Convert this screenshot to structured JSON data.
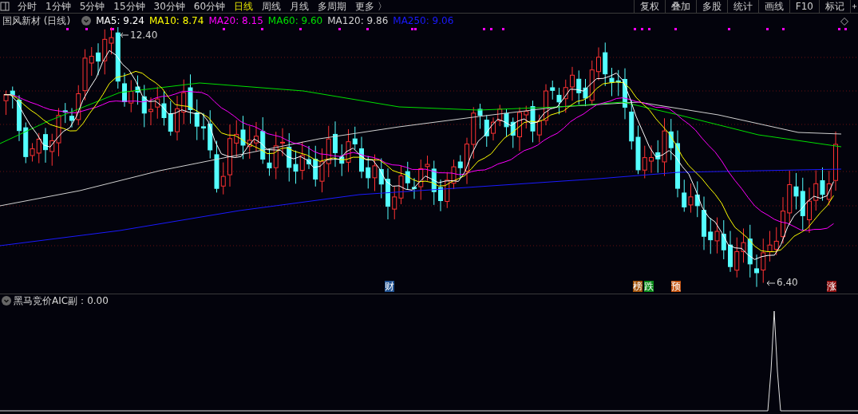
{
  "toolbar": {
    "periods": [
      {
        "label": "分时",
        "selected": false
      },
      {
        "label": "1分钟",
        "selected": false
      },
      {
        "label": "5分钟",
        "selected": false
      },
      {
        "label": "15分钟",
        "selected": false
      },
      {
        "label": "30分钟",
        "selected": false
      },
      {
        "label": "60分钟",
        "selected": false
      },
      {
        "label": "日线",
        "selected": true
      },
      {
        "label": "周线",
        "selected": false
      },
      {
        "label": "月线",
        "selected": false
      },
      {
        "label": "多周期",
        "selected": false
      },
      {
        "label": "更多 〉",
        "selected": false
      }
    ],
    "tools": [
      "复权",
      "叠加",
      "多股",
      "统计",
      "画线",
      "F10",
      "标记"
    ]
  },
  "chart": {
    "title": "国风新材 (日线)",
    "legend": [
      {
        "label": "MA5: 9.24",
        "color": "#ffffff"
      },
      {
        "label": "MA10: 8.74",
        "color": "#ffff00"
      },
      {
        "label": "MA20: 8.15",
        "color": "#ff00ff"
      },
      {
        "label": "MA60: 9.60",
        "color": "#00e000"
      },
      {
        "label": "MA120: 9.86",
        "color": "#d0d0d0"
      },
      {
        "label": "MA250: 9.06",
        "color": "#1a1aff"
      }
    ],
    "high_label": "12.40",
    "low_label": "6.40",
    "events": [
      {
        "label": "财",
        "color": "#1e4f8f"
      },
      {
        "label": "榜",
        "color": "#a0520a"
      },
      {
        "label": "跌",
        "color": "#0a8a1a"
      },
      {
        "label": "预",
        "color": "#c2510d"
      },
      {
        "label": "涨",
        "color": "#8a0f0f"
      }
    ]
  },
  "indicator": {
    "title": "黑马竞价AIC副：0.00"
  }
}
